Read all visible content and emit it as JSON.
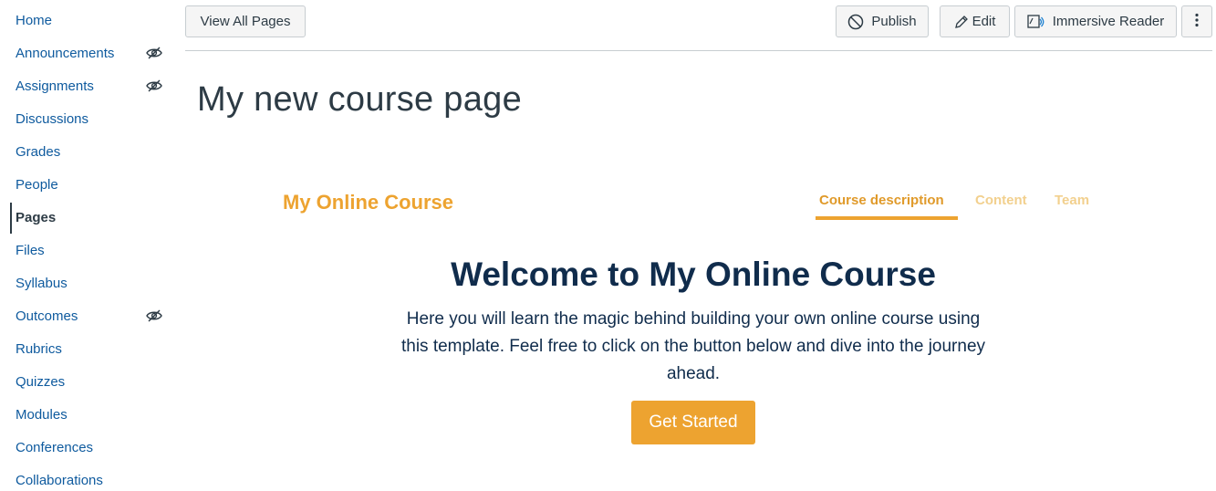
{
  "sidebar": {
    "items": [
      {
        "label": "Home"
      },
      {
        "label": "Announcements",
        "icon": "eye-slash-icon"
      },
      {
        "label": "Assignments",
        "icon": "eye-slash-icon"
      },
      {
        "label": "Discussions"
      },
      {
        "label": "Grades"
      },
      {
        "label": "People"
      },
      {
        "label": "Pages",
        "active": true
      },
      {
        "label": "Files"
      },
      {
        "label": "Syllabus"
      },
      {
        "label": "Outcomes",
        "icon": "eye-slash-icon"
      },
      {
        "label": "Rubrics"
      },
      {
        "label": "Quizzes"
      },
      {
        "label": "Modules"
      },
      {
        "label": "Conferences"
      },
      {
        "label": "Collaborations"
      }
    ]
  },
  "toolbar": {
    "view_all_label": "View All Pages",
    "publish_label": "Publish",
    "edit_label": "Edit",
    "immersive_label": "Immersive Reader",
    "more_icon": "kebab-menu-icon"
  },
  "page": {
    "title": "My new course page"
  },
  "template": {
    "brand": "My Online Course",
    "tabs": [
      {
        "label": "Course description",
        "active": true
      },
      {
        "label": "Content",
        "active": false
      },
      {
        "label": "Team",
        "active": false
      }
    ],
    "hero_title": "Welcome to My Online Course",
    "hero_line1": "Here you will learn the magic behind building your own online course using",
    "hero_line2": "this template. Feel free to click on the button below and dive into the journey",
    "hero_line3": "ahead.",
    "cta_label": "Get Started"
  },
  "colors": {
    "link": "#0e5a9e",
    "accent": "#eda330",
    "heading_navy": "#102c4c",
    "text": "#2d3b45"
  }
}
